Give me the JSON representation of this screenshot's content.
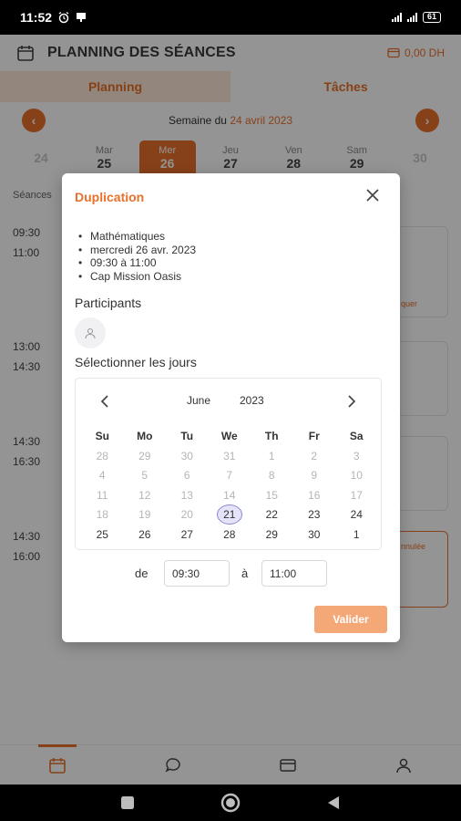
{
  "status_bar": {
    "time": "11:52",
    "battery": "61"
  },
  "header": {
    "title": "PLANNING DES SÉANCES",
    "balance": "0,00 DH"
  },
  "tabs": [
    {
      "label": "Planning"
    },
    {
      "label": "Tâches"
    }
  ],
  "week": {
    "prefix": "Semaine du",
    "date": "24 avril 2023"
  },
  "days": [
    {
      "name": "",
      "num": "24"
    },
    {
      "name": "Mar",
      "num": "25"
    },
    {
      "name": "Mer",
      "num": "26"
    },
    {
      "name": "Jeu",
      "num": "27"
    },
    {
      "name": "Ven",
      "num": "28"
    },
    {
      "name": "Sam",
      "num": "29"
    },
    {
      "name": "",
      "num": "30"
    }
  ],
  "background": {
    "seances_label": "Séances",
    "times": [
      {
        "start": "09:30",
        "end": "11:00"
      },
      {
        "start": "13:00",
        "end": "14:30"
      },
      {
        "start": "14:30",
        "end": "16:30"
      },
      {
        "start": "14:30",
        "end": "16:00"
      }
    ],
    "card_texts": [
      "quer",
      "nnulée"
    ]
  },
  "modal": {
    "title": "Duplication",
    "details": [
      "Mathématiques",
      "mercredi 26 avr. 2023",
      "09:30 à 11:00",
      "Cap Mission Oasis"
    ],
    "participants_label": "Participants",
    "select_days_label": "Sélectionner les jours",
    "calendar": {
      "month": "June",
      "year": "2023",
      "weekdays": [
        "Su",
        "Mo",
        "Tu",
        "We",
        "Th",
        "Fr",
        "Sa"
      ],
      "weeks": [
        [
          "28",
          "29",
          "30",
          "31",
          "1",
          "2",
          "3"
        ],
        [
          "4",
          "5",
          "6",
          "7",
          "8",
          "9",
          "10"
        ],
        [
          "11",
          "12",
          "13",
          "14",
          "15",
          "16",
          "17"
        ],
        [
          "18",
          "19",
          "20",
          "21",
          "22",
          "23",
          "24"
        ],
        [
          "25",
          "26",
          "27",
          "28",
          "29",
          "30",
          "1"
        ]
      ],
      "selected": "21"
    },
    "time": {
      "from_label": "de",
      "from_value": "09:30",
      "to_label": "à",
      "to_value": "11:00"
    },
    "submit_label": "Valider"
  },
  "colors": {
    "accent": "#e8712b",
    "accent_light": "#f4a877",
    "selected_day": "#8a86d6"
  }
}
